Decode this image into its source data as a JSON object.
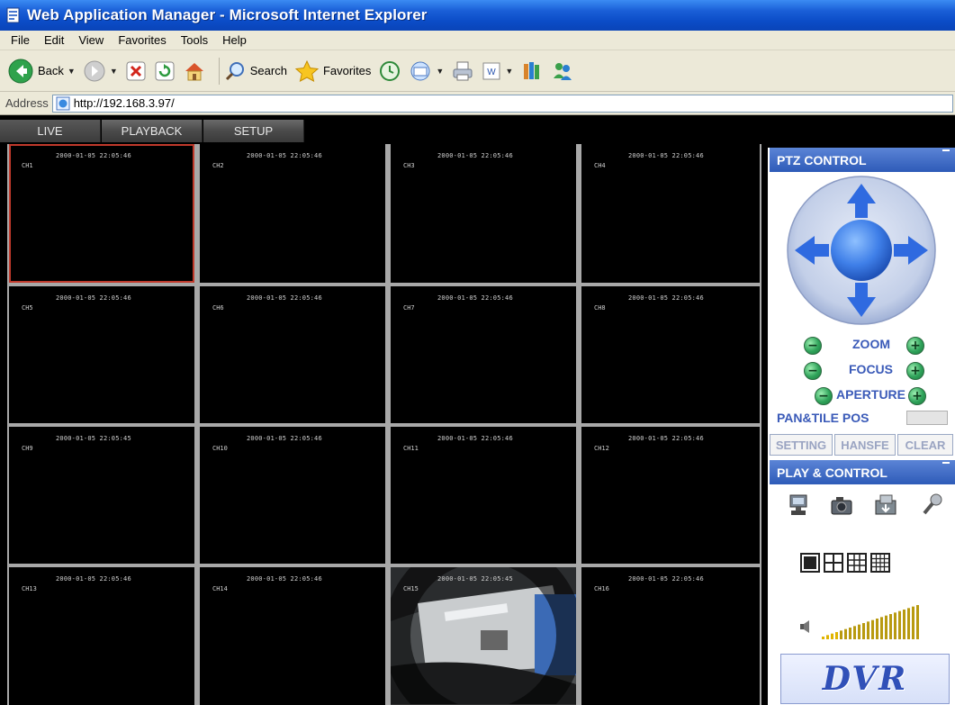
{
  "window": {
    "title": "Web Application Manager - Microsoft Internet Explorer"
  },
  "menu": [
    "File",
    "Edit",
    "View",
    "Favorites",
    "Tools",
    "Help"
  ],
  "toolbar": {
    "back_label": "Back",
    "search_label": "Search",
    "favorites_label": "Favorites"
  },
  "address": {
    "label": "Address",
    "url": "http://192.168.3.97/"
  },
  "tabs": [
    "LIVE",
    "PLAYBACK",
    "SETUP"
  ],
  "channels": [
    {
      "id": "CH1",
      "timestamp": "2000-01-05 22:05:46"
    },
    {
      "id": "CH2",
      "timestamp": "2000-01-05 22:05:46"
    },
    {
      "id": "CH3",
      "timestamp": "2000-01-05 22:05:46"
    },
    {
      "id": "CH4",
      "timestamp": "2000-01-05 22:05:46"
    },
    {
      "id": "CH5",
      "timestamp": "2000-01-05 22:05:46"
    },
    {
      "id": "CH6",
      "timestamp": "2000-01-05 22:05:46"
    },
    {
      "id": "CH7",
      "timestamp": "2000-01-05 22:05:46"
    },
    {
      "id": "CH8",
      "timestamp": "2000-01-05 22:05:46"
    },
    {
      "id": "CH9",
      "timestamp": "2000-01-05 22:05:45"
    },
    {
      "id": "CH10",
      "timestamp": "2000-01-05 22:05:46"
    },
    {
      "id": "CH11",
      "timestamp": "2000-01-05 22:05:46"
    },
    {
      "id": "CH12",
      "timestamp": "2000-01-05 22:05:46"
    },
    {
      "id": "CH13",
      "timestamp": "2000-01-05 22:05:46"
    },
    {
      "id": "CH14",
      "timestamp": "2000-01-05 22:05:46"
    },
    {
      "id": "CH15",
      "timestamp": "2000-01-05 22:05:45"
    },
    {
      "id": "CH16",
      "timestamp": "2000-01-05 22:05:46"
    }
  ],
  "ptz": {
    "header": "PTZ CONTROL",
    "zoom_label": "ZOOM",
    "focus_label": "FOCUS",
    "aperture_label": "APERTURE",
    "pantile_label": "PAN&TILE POS",
    "setting_label": "SETTING",
    "hansfe_label": "HANSFE",
    "clear_label": "CLEAR"
  },
  "play": {
    "header": "PLAY & CONTROL",
    "logo_text": "DVR"
  },
  "colors": {
    "title_blue": "#0b4cc7",
    "panel_blue": "#2e5bb8",
    "grid_border": "#a8a8a8",
    "selected_cell": "#c0392b",
    "dpad_blue": "#3f7fe8"
  }
}
